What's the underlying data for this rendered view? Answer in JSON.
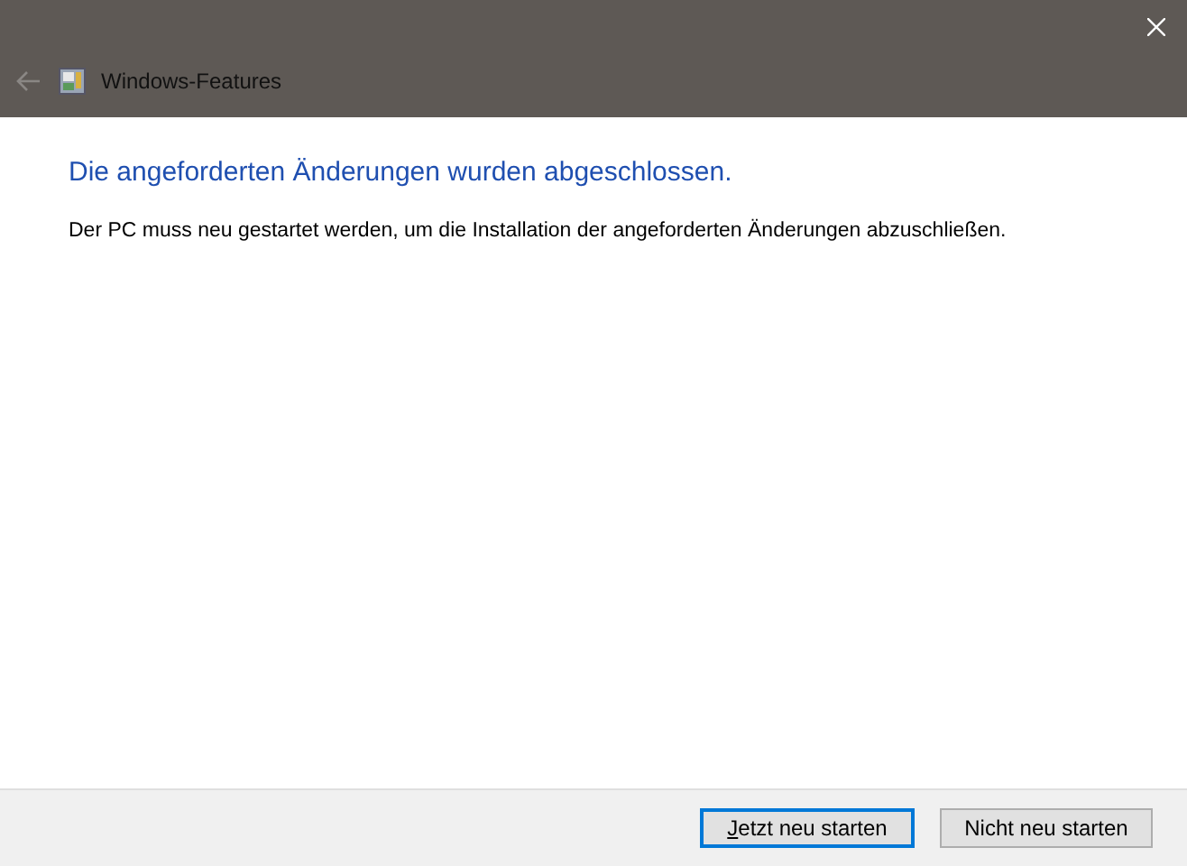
{
  "window": {
    "title": "Windows-Features",
    "back_disabled": true
  },
  "heading": "Die angeforderten Änderungen wurden abgeschlossen.",
  "message": "Der PC muss neu gestartet werden, um die Installation der angeforderten Änderungen abzuschließen.",
  "buttons": [
    {
      "label": "Jetzt neu starten",
      "focused": true
    },
    {
      "label": "Nicht neu starten",
      "focused": false
    }
  ]
}
